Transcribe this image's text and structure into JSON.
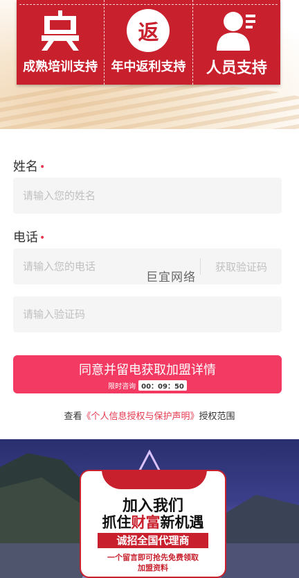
{
  "support": {
    "items": [
      {
        "label": "成熟培训支持",
        "icon": "training-icon"
      },
      {
        "label": "年中返利支持",
        "icon": "rebate-icon",
        "glyph": "返"
      },
      {
        "label": "人员支持",
        "icon": "person-icon"
      }
    ]
  },
  "form": {
    "name_label": "姓名",
    "name_placeholder": "请输入您的姓名",
    "phone_label": "电话",
    "phone_placeholder": "请输入您的电话",
    "get_code_label": "获取验证码",
    "code_placeholder": "请输入验证码",
    "required_mark": "•",
    "watermark": "巨宜网络"
  },
  "submit": {
    "label": "同意并留电获取加盟详情",
    "limited_label": "限时咨询",
    "timer": "00：09：50"
  },
  "policy": {
    "prefix": "查看",
    "link": "《个人信息授权与保护声明》",
    "suffix": "授权范围"
  },
  "promo": {
    "line1": "加入我们",
    "line2_a": "抓住",
    "line2_b": "财富",
    "line2_c": "新机遇",
    "ribbon": "诚招全国代理商",
    "line3": "一个留言即可抢先免费领取",
    "line4": "加盟资料"
  },
  "colors": {
    "brand_red": "#c8202d",
    "button_pink": "#f23a62",
    "required_red": "#e8384f"
  }
}
